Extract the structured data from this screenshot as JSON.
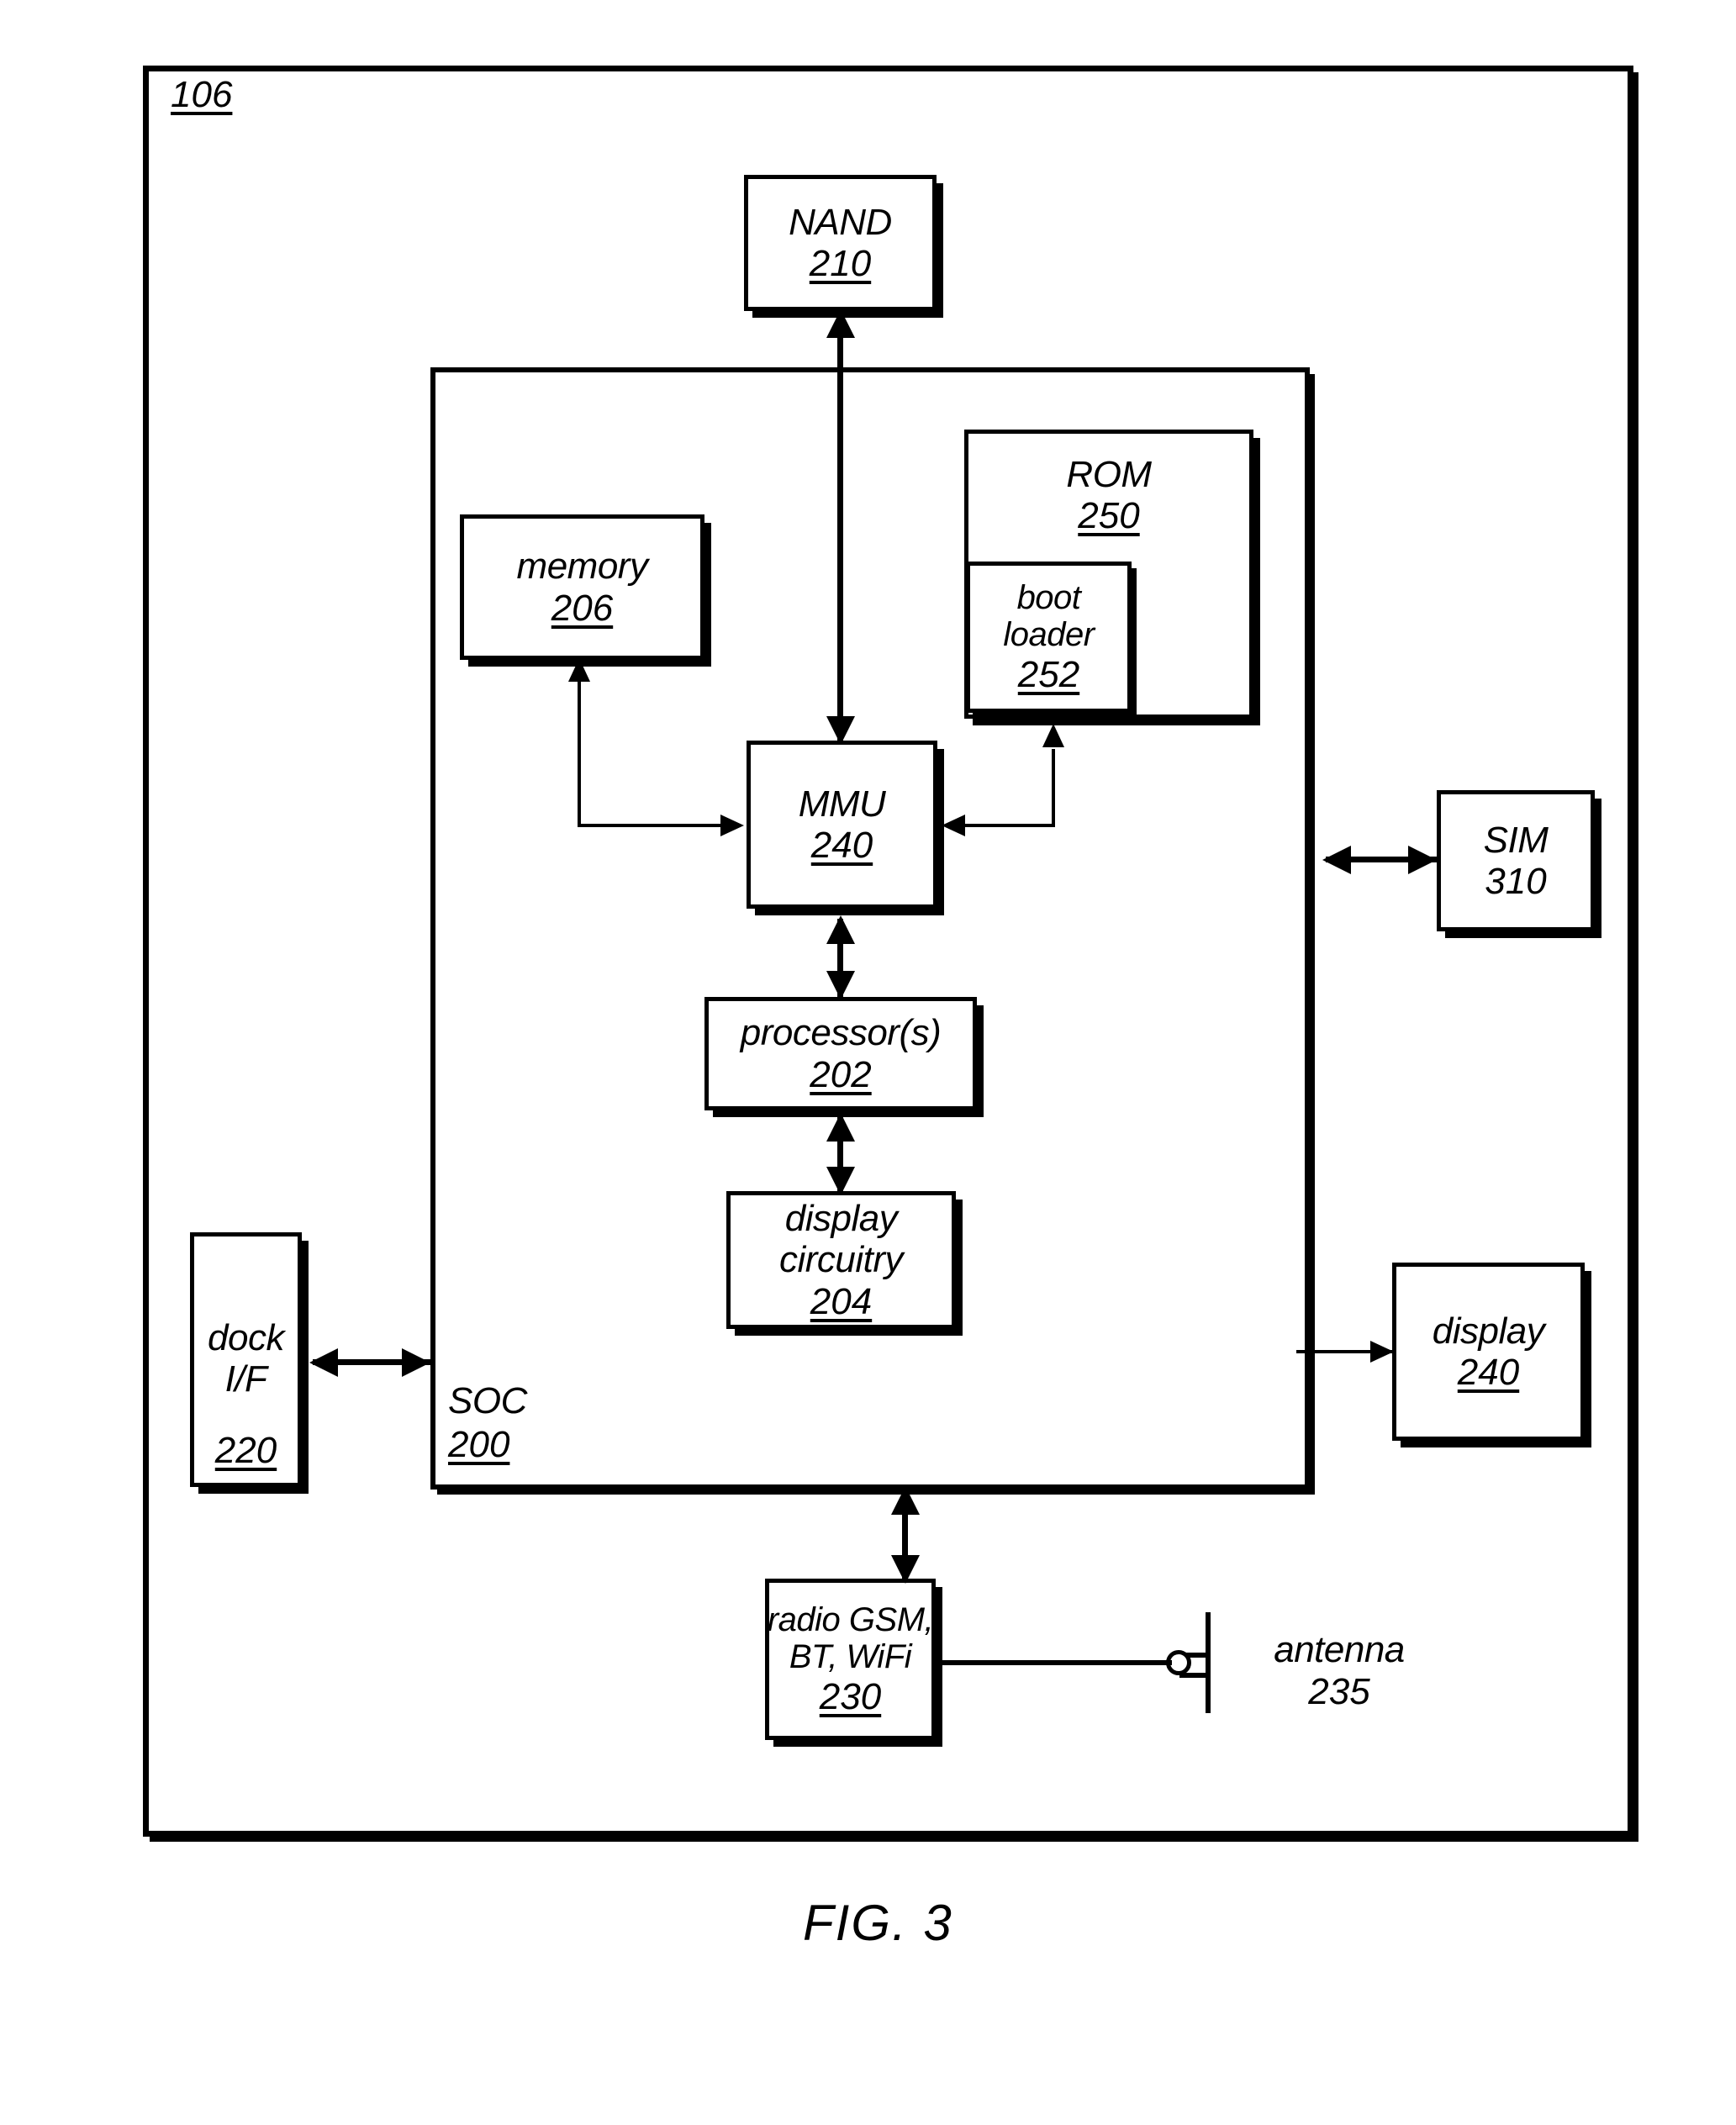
{
  "figure": {
    "caption": "FIG. 3",
    "device_ref": "106"
  },
  "blocks": {
    "nand": {
      "label": "NAND",
      "ref": "210"
    },
    "rom": {
      "label": "ROM",
      "ref": "250"
    },
    "bootloader": {
      "label_line1": "boot",
      "label_line2": "loader",
      "ref": "252"
    },
    "memory": {
      "label": "memory",
      "ref": "206"
    },
    "mmu": {
      "label": "MMU",
      "ref": "240"
    },
    "processor": {
      "label": "processor(s)",
      "ref": "202"
    },
    "display_circuitry": {
      "label_line1": "display",
      "label_line2": "circuitry",
      "ref": "204"
    },
    "soc": {
      "label": "SOC",
      "ref": "200"
    },
    "dock": {
      "label_line1": "dock",
      "label_line2": "I/F",
      "ref": "220"
    },
    "sim": {
      "label": "SIM",
      "ref": "310"
    },
    "display": {
      "label": "display",
      "ref": "240"
    },
    "radio": {
      "label_line1": "radio GSM,",
      "label_line2": "BT, WiFi",
      "ref": "230"
    },
    "antenna": {
      "label": "antenna",
      "ref": "235"
    }
  },
  "connections": [
    {
      "from": "mmu",
      "to": "nand",
      "type": "bidirectional-vertical"
    },
    {
      "from": "mmu",
      "to": "memory",
      "type": "unidirectional-elbow"
    },
    {
      "from": "bootloader",
      "to": "mmu",
      "type": "unidirectional-elbow"
    },
    {
      "from": "mmu",
      "to": "processor",
      "type": "bidirectional-vertical"
    },
    {
      "from": "processor",
      "to": "display_circuitry",
      "type": "bidirectional-vertical"
    },
    {
      "from": "dock",
      "to": "soc",
      "type": "bidirectional-horizontal"
    },
    {
      "from": "soc",
      "to": "sim",
      "type": "bidirectional-horizontal"
    },
    {
      "from": "soc",
      "to": "display",
      "type": "unidirectional-horizontal"
    },
    {
      "from": "soc",
      "to": "radio",
      "type": "bidirectional-vertical"
    },
    {
      "from": "radio",
      "to": "antenna",
      "type": "line"
    }
  ],
  "colors": {
    "ink": "#000000",
    "paper": "#ffffff"
  }
}
